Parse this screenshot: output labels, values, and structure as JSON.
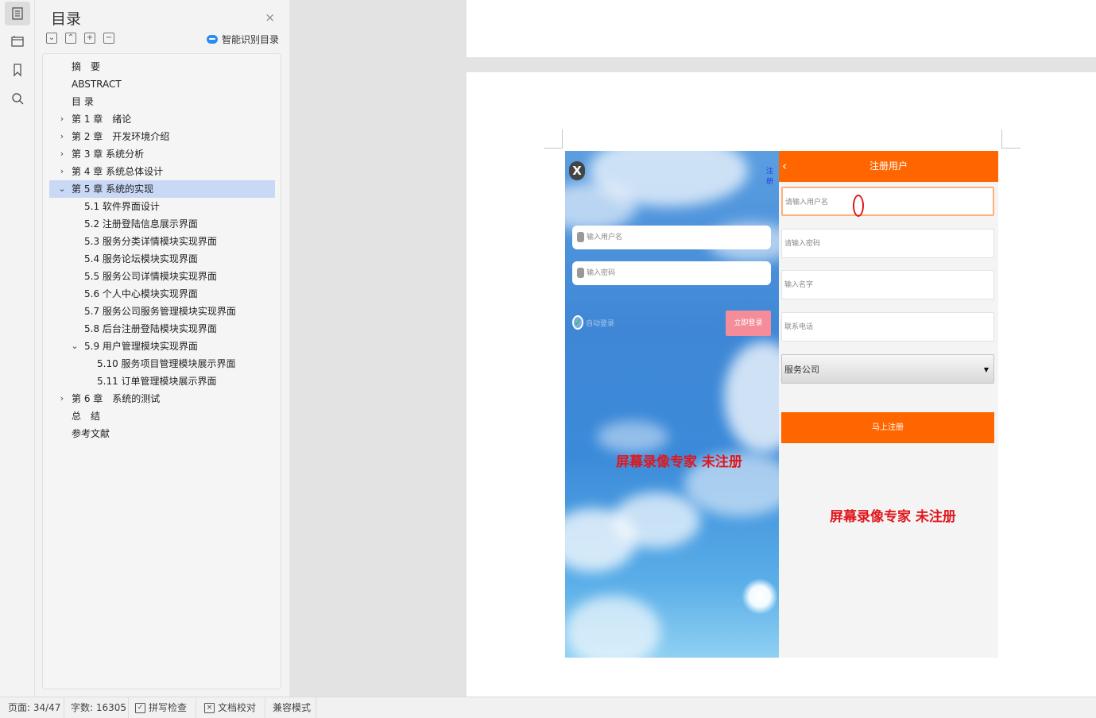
{
  "rail": [
    {
      "name": "toc-rail-icon",
      "active": true
    },
    {
      "name": "navigation-rail-icon",
      "active": false
    },
    {
      "name": "bookmark-rail-icon",
      "active": false
    },
    {
      "name": "search-rail-icon",
      "active": false
    }
  ],
  "toc": {
    "title": "目录",
    "close": "×",
    "smart_label": "智能识别目录",
    "tools": [
      "⌄",
      "⌃",
      "+",
      "−"
    ],
    "items": [
      {
        "text": "摘　要",
        "level": 0,
        "arrow": ""
      },
      {
        "text": "ABSTRACT",
        "level": 0,
        "arrow": ""
      },
      {
        "text": "目 录",
        "level": 0,
        "arrow": ""
      },
      {
        "text": "第 1 章　绪论",
        "level": 0,
        "arrow": "›"
      },
      {
        "text": "第 2 章　开发环境介绍",
        "level": 0,
        "arrow": "›"
      },
      {
        "text": "第 3 章 系统分析",
        "level": 0,
        "arrow": "›"
      },
      {
        "text": "第 4 章 系统总体设计",
        "level": 0,
        "arrow": "›"
      },
      {
        "text": "第 5 章 系统的实现",
        "level": 0,
        "arrow": "⌄",
        "selected": true
      },
      {
        "text": "5.1 软件界面设计",
        "level": 1,
        "arrow": ""
      },
      {
        "text": "5.2 注册登陆信息展示界面",
        "level": 1,
        "arrow": ""
      },
      {
        "text": "5.3 服务分类详情模块实现界面",
        "level": 1,
        "arrow": ""
      },
      {
        "text": "5.4 服务论坛模块实现界面",
        "level": 1,
        "arrow": ""
      },
      {
        "text": "5.5 服务公司详情模块实现界面",
        "level": 1,
        "arrow": ""
      },
      {
        "text": "5.6 个人中心模块实现界面",
        "level": 1,
        "arrow": ""
      },
      {
        "text": "5.7 服务公司服务管理模块实现界面",
        "level": 1,
        "arrow": ""
      },
      {
        "text": "5.8 后台注册登陆模块实现界面",
        "level": 1,
        "arrow": ""
      },
      {
        "text": "5.9 用户管理模块实现界面",
        "level": 1,
        "arrow": "⌄"
      },
      {
        "text": "5.10 服务项目管理模块展示界面",
        "level": 2,
        "arrow": ""
      },
      {
        "text": "5.11 订单管理模块展示界面",
        "level": 2,
        "arrow": ""
      },
      {
        "text": "第 6 章　系统的测试",
        "level": 0,
        "arrow": "›"
      },
      {
        "text": "总　结",
        "level": 0,
        "arrow": ""
      },
      {
        "text": "参考文献",
        "level": 0,
        "arrow": ""
      }
    ]
  },
  "doc": {
    "prev_page_number": "34",
    "login": {
      "close": "X",
      "register_link": "注册",
      "username_placeholder": "输入用户名",
      "password_placeholder": "输入密码",
      "auto_login": "自动登录",
      "login_button": "立即登录",
      "watermark": "屏幕录像专家 未注册"
    },
    "register": {
      "title": "注册用户",
      "back": "‹",
      "username_placeholder": "请输入用户名",
      "password_placeholder": "请输入密码",
      "name_placeholder": "输入名字",
      "phone_placeholder": "联系电话",
      "company_select": "服务公司",
      "submit": "马上注册",
      "watermark": "屏幕录像专家 未注册"
    }
  },
  "status": {
    "page": "页面: 34/47",
    "words": "字数: 16305",
    "spell": "拼写检查",
    "proof": "文档校对",
    "compat": "兼容模式"
  },
  "colors": {
    "accent_orange": "#ff6600",
    "toc_selected": "#c8d8f5",
    "watermark_red": "#e0171c"
  }
}
